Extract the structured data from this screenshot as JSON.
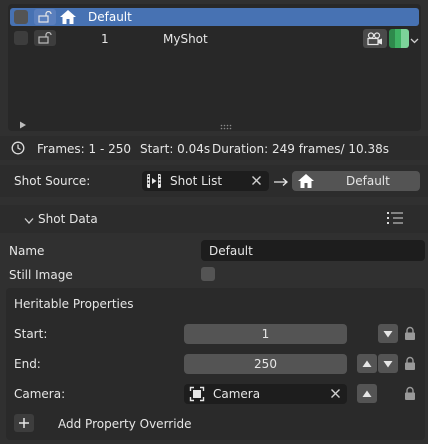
{
  "shot_list": {
    "rows": [
      {
        "label": "Default",
        "selected": true
      },
      {
        "index": "1",
        "name": "MyShot",
        "selected": false
      }
    ]
  },
  "info": {
    "frames": "Frames: 1 - 250",
    "start": "Start: 0.04s",
    "duration": "Duration: 249 frames/ 10.38s"
  },
  "shot_source": {
    "label": "Shot Source:",
    "source_value": "Shot List",
    "target_value": "Default"
  },
  "shot_data": {
    "header": "Shot Data",
    "name_label": "Name",
    "name_value": "Default",
    "still_image_label": "Still Image",
    "still_image_checked": false
  },
  "heritable": {
    "title": "Heritable Properties",
    "start_label": "Start:",
    "start_value": "1",
    "end_label": "End:",
    "end_value": "250",
    "camera_label": "Camera:",
    "camera_value": "Camera",
    "add_override": "Add Property Override"
  },
  "colors": {
    "accent": "#4772b3",
    "panel": "#303030",
    "field": "#545454"
  },
  "icons": [
    "checkbox-icon",
    "lock-open-icon",
    "home-icon",
    "camera-icon",
    "color-swatch-icon",
    "chevron-down-icon",
    "clock-icon",
    "film-icon",
    "clear-icon",
    "arrow-right-icon",
    "list-icon",
    "object-icon",
    "triangle-up-icon",
    "triangle-down-icon",
    "lock-icon",
    "plus-icon",
    "play-triangle-icon"
  ]
}
